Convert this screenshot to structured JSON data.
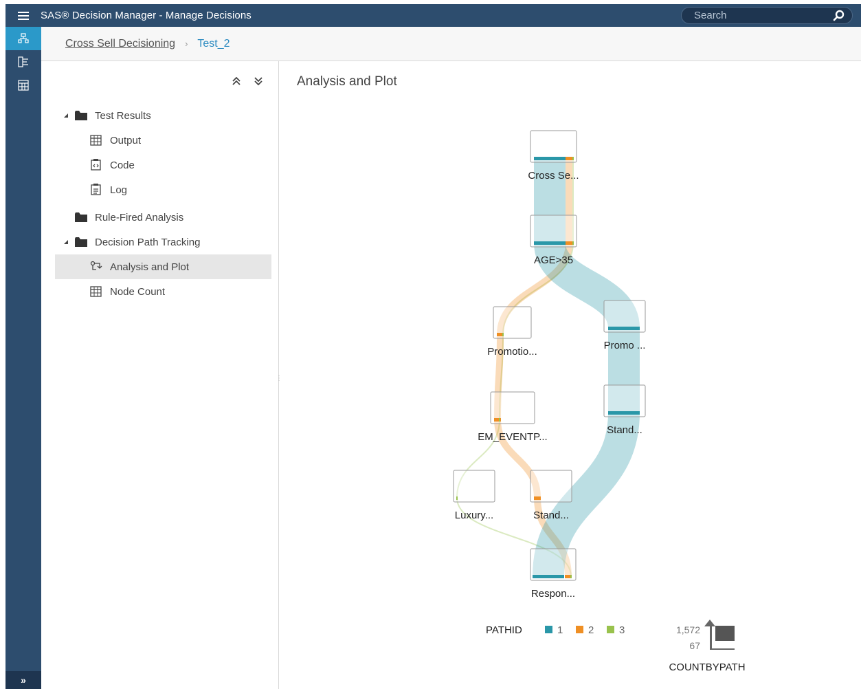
{
  "app": {
    "title": "SAS® Decision Manager - Manage Decisions"
  },
  "search": {
    "placeholder": "Search"
  },
  "breadcrumb": {
    "parent": "Cross Sell Decisioning",
    "separator": "›",
    "current": "Test_2"
  },
  "tree": {
    "items": [
      {
        "label": "Test Results",
        "kind": "folder",
        "expanded": true,
        "icon": "folder-icon"
      },
      {
        "label": "Output",
        "kind": "leaf",
        "icon": "table-icon"
      },
      {
        "label": "Code",
        "kind": "leaf",
        "icon": "code-icon"
      },
      {
        "label": "Log",
        "kind": "leaf",
        "icon": "log-icon"
      },
      {
        "label": "Rule-Fired Analysis",
        "kind": "folder",
        "expanded": false,
        "icon": "folder-icon"
      },
      {
        "label": "Decision Path Tracking",
        "kind": "folder",
        "expanded": true,
        "icon": "folder-icon"
      },
      {
        "label": "Analysis and Plot",
        "kind": "leaf",
        "selected": true,
        "icon": "path-icon"
      },
      {
        "label": "Node Count",
        "kind": "leaf",
        "icon": "table-icon"
      }
    ]
  },
  "main": {
    "title": "Analysis and Plot"
  },
  "chart_data": {
    "type": "sankey",
    "nodes": [
      {
        "id": "n1",
        "label": "Cross Se..."
      },
      {
        "id": "n2",
        "label": "AGE>35"
      },
      {
        "id": "n3",
        "label": "Promotio..."
      },
      {
        "id": "n4",
        "label": "Promo ..."
      },
      {
        "id": "n5",
        "label": "EM_EVENTP..."
      },
      {
        "id": "n6",
        "label": "Stand..."
      },
      {
        "id": "n7",
        "label": "Luxury..."
      },
      {
        "id": "n8",
        "label": "Stand..."
      },
      {
        "id": "n9",
        "label": "Respon..."
      }
    ],
    "paths": [
      {
        "pathid": "1",
        "color": "#2a97a8",
        "nodes": [
          "n1",
          "n2",
          "n4",
          "n6",
          "n9"
        ]
      },
      {
        "pathid": "2",
        "color": "#ef8f24",
        "nodes": [
          "n1",
          "n2",
          "n3",
          "n5",
          "n8",
          "n9"
        ]
      },
      {
        "pathid": "3",
        "color": "#99c24d",
        "nodes": [
          "n1",
          "n2",
          "n3",
          "n5",
          "n7",
          "n9"
        ]
      }
    ],
    "legend": {
      "title": "PATHID",
      "entries": [
        {
          "label": "1",
          "color": "#2a97a8"
        },
        {
          "label": "2",
          "color": "#ef8f24"
        },
        {
          "label": "3",
          "color": "#99c24d"
        }
      ]
    },
    "size_legend": {
      "title": "COUNTBYPATH",
      "max": "1,572",
      "min": "67"
    }
  }
}
